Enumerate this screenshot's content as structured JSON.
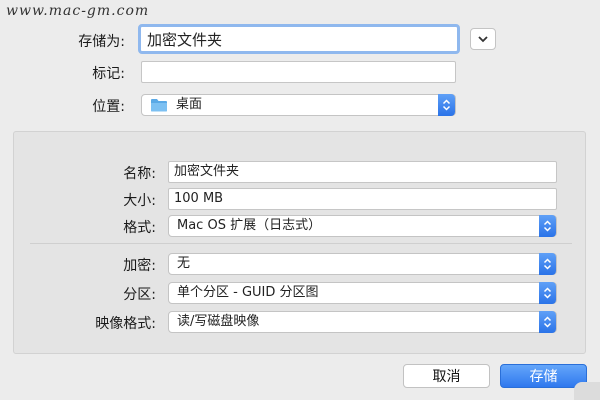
{
  "watermark": "www.mac-gm.com",
  "top": {
    "save_as_label": "存储为:",
    "save_as_value": "加密文件夹",
    "tags_label": "标记:",
    "tags_value": "",
    "location_label": "位置:",
    "location_value": "桌面",
    "location_icon": "folder-icon"
  },
  "options": {
    "name_label": "名称:",
    "name_value": "加密文件夹",
    "size_label": "大小:",
    "size_value": "100 MB",
    "format_label": "格式:",
    "format_value": "Mac OS 扩展（日志式）",
    "encryption_label": "加密:",
    "encryption_value": "无",
    "partitions_label": "分区:",
    "partitions_value": "单个分区 - GUID 分区图",
    "image_format_label": "映像格式:",
    "image_format_value": "读/写磁盘映像"
  },
  "buttons": {
    "cancel_label": "取消",
    "save_label": "存储"
  },
  "colors": {
    "accent": "#2f78ee",
    "focus_ring": "#8fb8ee",
    "folder": "#5aa9e6"
  }
}
